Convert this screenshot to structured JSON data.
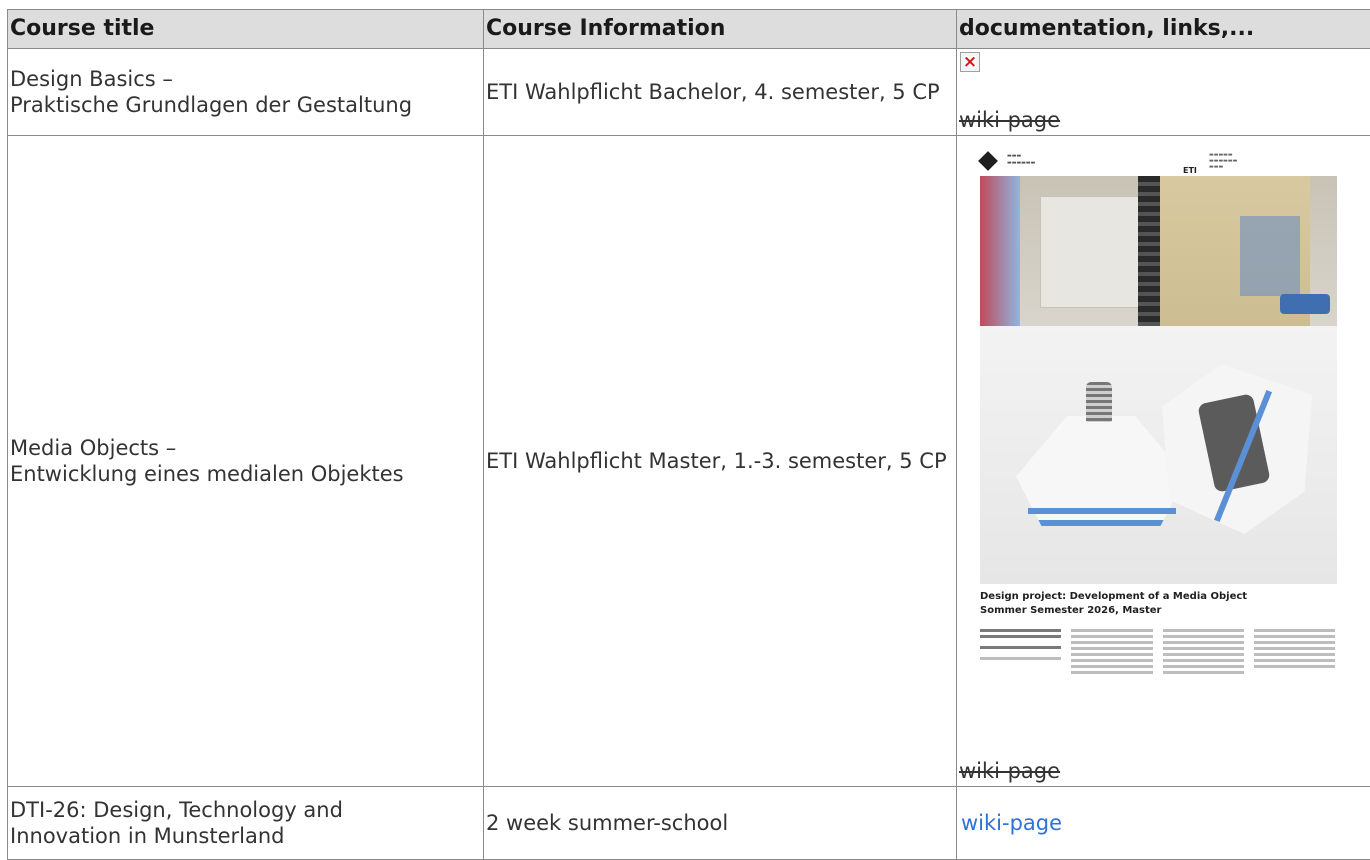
{
  "table": {
    "headers": [
      "Course title",
      "Course Information",
      "documentation, links,..."
    ],
    "rows": [
      {
        "title_line1": "Design Basics –",
        "title_line2": "Praktische Grundlagen der Gestaltung",
        "info": "ETI Wahlpflicht Bachelor, 4. semester, 5 CP",
        "doc_link": "wiki-page"
      },
      {
        "title_line1": "Media Objects –",
        "title_line2": "Entwicklung eines medialen Objektes",
        "info": "ETI Wahlpflicht Master, 1.-3. semester, 5 CP",
        "doc_link": "wiki-page",
        "poster": {
          "headline_line1": "Design project: Development of a Media Object",
          "headline_line2": "Sommer Semester 2026, Master",
          "eti": "ETI"
        }
      },
      {
        "title_line1": "DTI-26: Design, Technology and",
        "title_line2": "Innovation in Munsterland",
        "info": "2 week summer-school",
        "doc_link": "wiki-page"
      }
    ]
  },
  "colors": {
    "header_bg": "#dddddd",
    "border": "#8a8a8a",
    "link": "#2b73d6",
    "broken_image_x": "#d01818"
  },
  "icons": [
    "broken-image-icon"
  ]
}
